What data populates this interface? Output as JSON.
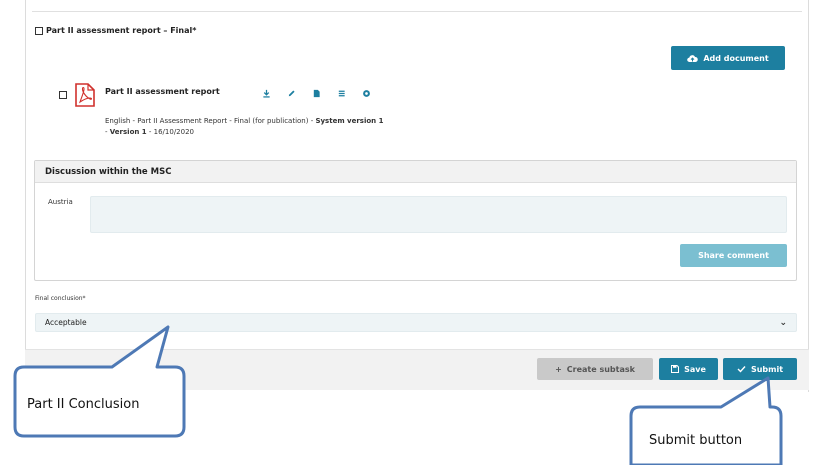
{
  "section": {
    "title": "Part II assessment report – Final*"
  },
  "add_document": {
    "label": "Add document"
  },
  "document": {
    "title": "Part II assessment report",
    "meta_line1_prefix": "English - Part II Assessment Report - Final (for publication) - ",
    "meta_line1_bold": "System version 1",
    "meta_line2_prefix": "- ",
    "meta_line2_bold": "Version 1",
    "meta_line2_suffix": " - 16/10/2020"
  },
  "discussion": {
    "title": "Discussion within the MSC",
    "country": "Austria",
    "share_label": "Share comment"
  },
  "final_conclusion": {
    "label": "Final conclusion*",
    "value": "Acceptable"
  },
  "footer": {
    "create_subtask": "Create subtask",
    "save": "Save",
    "submit": "Submit"
  },
  "callouts": {
    "conclusion": "Part II Conclusion",
    "submit": "Submit button"
  },
  "colors": {
    "primary_button": "#1d7fa0",
    "share_button": "#7bbfd1",
    "disabled_button": "#c9c9c9",
    "callout_border": "#4e79b5"
  }
}
